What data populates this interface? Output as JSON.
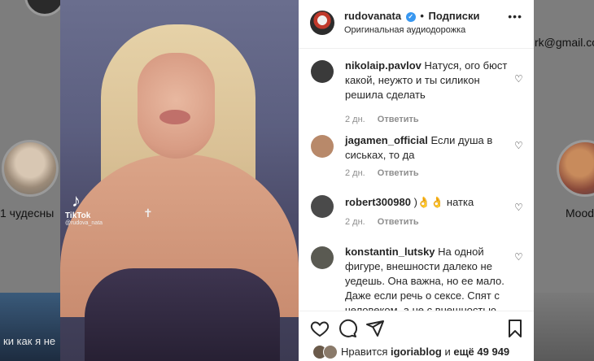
{
  "background": {
    "left_caption": "1 чудесны",
    "right_caption": "Mood",
    "right_top_text": "rk@gmail.co",
    "bottom_left_caption": "ки как я не"
  },
  "video": {
    "watermark_brand": "TikTok",
    "watermark_handle": "@rudova_nata"
  },
  "post": {
    "username": "rudovanata",
    "follow_label": "Подписки",
    "audio_label": "Оригинальная аудиодорожка",
    "more_label": "•••"
  },
  "comments": [
    {
      "user": "nikolaip.pavlov",
      "text": "Натуся, ого бюст какой, неужто и ты силикон решила сделать",
      "time": "2 дн.",
      "reply": "Ответить",
      "avatar_color": "#3a3a3a"
    },
    {
      "user": "jagamen_official",
      "text": "Если душа в сиськах, то да",
      "time": "2 дн.",
      "reply": "Ответить",
      "avatar_color": "#b8896a"
    },
    {
      "user": "robert300980",
      "text": ")👌👌 натка",
      "time": "2 дн.",
      "reply": "Ответить",
      "avatar_color": "#4a4a4a"
    },
    {
      "user": "konstantin_lutsky",
      "text": "На одной фигуре, внешности далеко не уедешь. Она важна, но ее мало. Даже если речь о сексе. Спят с человеком, а не с внешностью. И",
      "time": "",
      "reply": "",
      "avatar_color": "#5a5a52"
    }
  ],
  "likes": {
    "prefix": "Нравится",
    "user": "igoriablog",
    "and": "и",
    "others": "ещё 49 949"
  },
  "colors": {
    "accent": "#3897f0",
    "text": "#262626",
    "muted": "#8e8e8e"
  }
}
